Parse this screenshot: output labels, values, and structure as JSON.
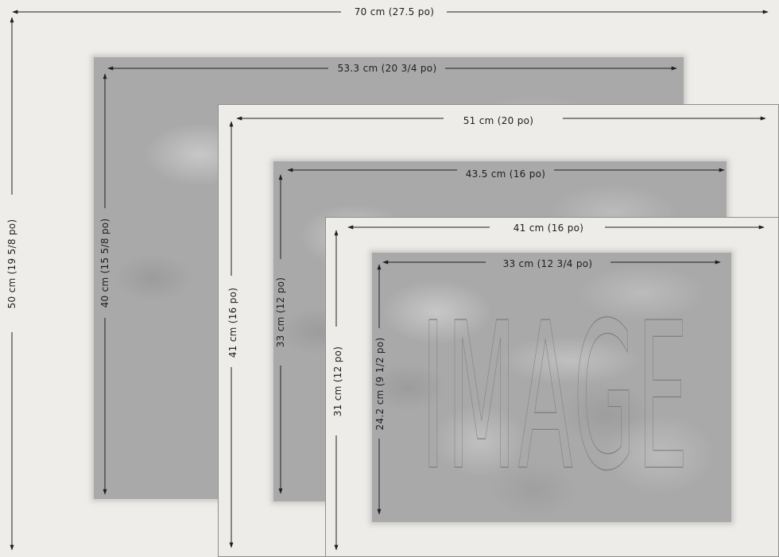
{
  "dimensions": {
    "outer_width": "70 cm (27.5 po)",
    "outer_height": "50 cm (19 5/8 po)",
    "image1_width": "53.3 cm (20 3/4 po)",
    "image1_height": "40 cm (15 5/8 po)",
    "frame2_width": "51 cm (20 po)",
    "frame2_height": "41 cm (16 po)",
    "image2_width": "43.5 cm (16 po)",
    "image2_height": "33 cm (12 po)",
    "frame3_width": "41 cm (16 po)",
    "frame3_height": "31 cm (12 po)",
    "image3_width": "33 cm (12 3/4 po)",
    "image3_height": "24.2 cm (9 1/2 po)"
  },
  "placeholder_word": "IMAGE",
  "colors": {
    "background": "#efede9",
    "line": "#1e1e1e",
    "frame_border": "#8d8d8d",
    "photo_gray": "#a9a9a9"
  }
}
